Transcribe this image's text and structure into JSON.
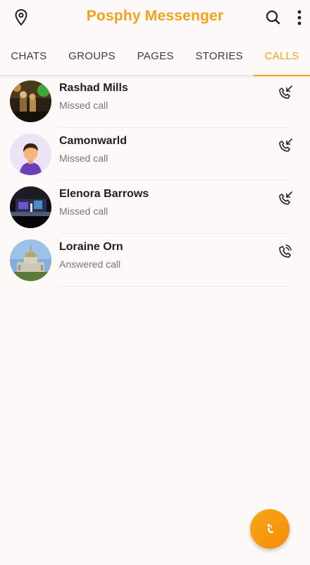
{
  "app": {
    "title": "Posphy Messenger"
  },
  "tabs": [
    {
      "label": "CHATS"
    },
    {
      "label": "GROUPS"
    },
    {
      "label": "PAGES"
    },
    {
      "label": "STORIES"
    },
    {
      "label": "CALLS",
      "active": true
    }
  ],
  "calls": [
    {
      "name": "Rashad Mills",
      "status": "Missed call",
      "icon": "missed-call-icon"
    },
    {
      "name": "Camonwarld",
      "status": "Missed call",
      "icon": "missed-call-icon"
    },
    {
      "name": "Elenora Barrows",
      "status": "Missed call",
      "icon": "missed-call-icon"
    },
    {
      "name": "Loraine Orn",
      "status": "Answered call",
      "icon": "answered-call-icon"
    }
  ],
  "colors": {
    "accent": "#f5a11c",
    "background": "#fdf9f8"
  },
  "icons": {
    "top_left": "location-pin-icon",
    "search": "search-icon",
    "menu": "more-vertical-icon",
    "fab": "new-call-icon"
  }
}
